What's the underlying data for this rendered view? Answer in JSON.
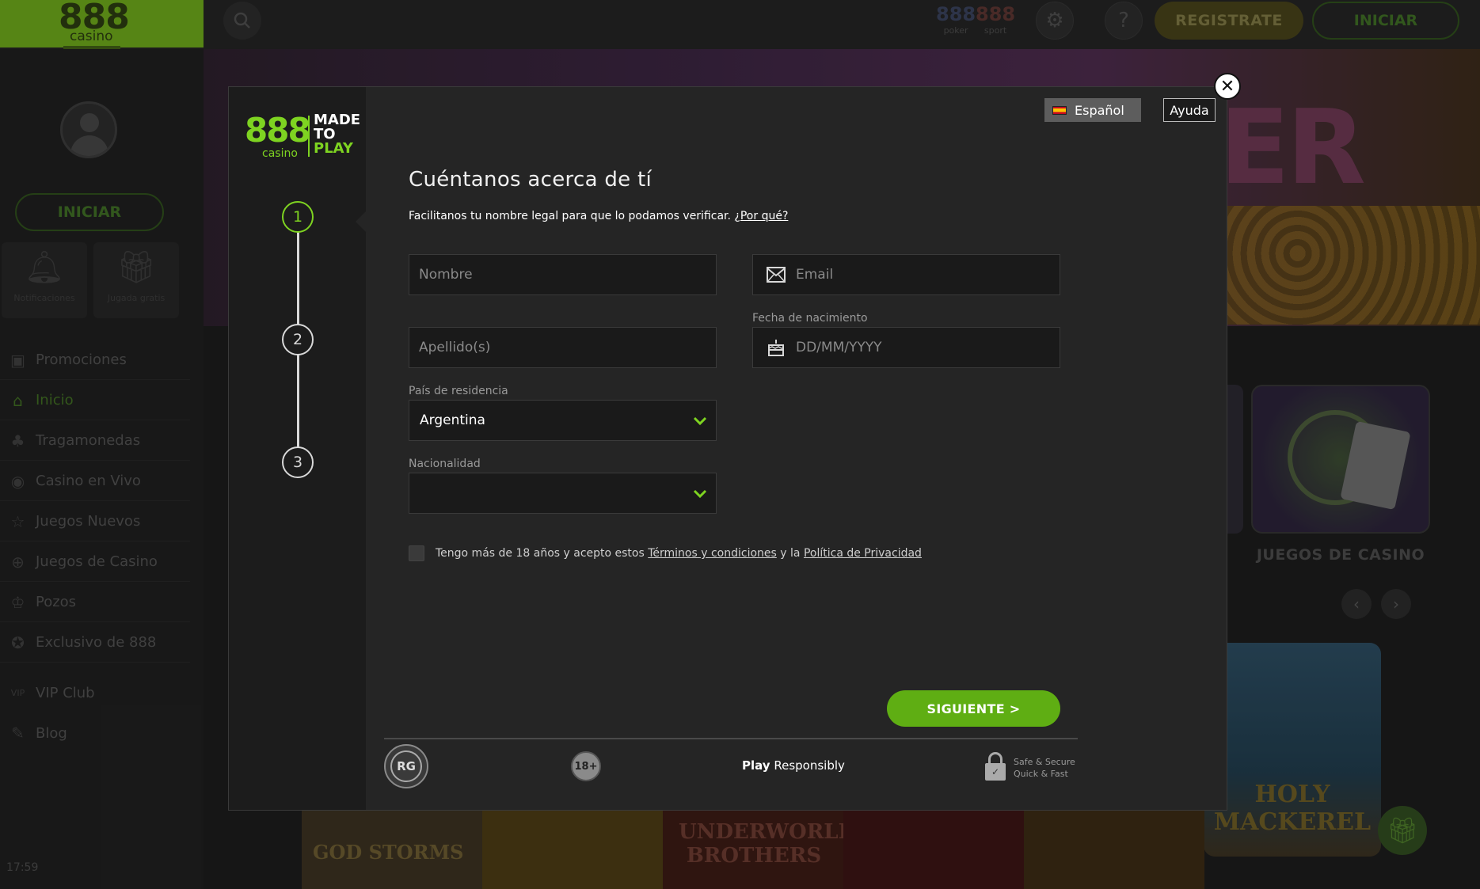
{
  "header": {
    "logo_main": "888",
    "logo_sub": "casino",
    "brands": [
      {
        "name": "888",
        "sub": "poker"
      },
      {
        "name": "888",
        "sub": "sport"
      }
    ],
    "register_label": "REGISTRATE",
    "login_label": "INICIAR"
  },
  "sidebar": {
    "login_label": "INICIAR",
    "tiles": [
      "Notificaciones",
      "Jugada gratis"
    ],
    "items": [
      {
        "label": "Promociones",
        "icon": "gift-icon"
      },
      {
        "label": "Inicio",
        "icon": "home-icon"
      },
      {
        "label": "Tragamonedas",
        "icon": "cherries-icon"
      },
      {
        "label": "Casino en Vivo",
        "icon": "live-icon"
      },
      {
        "label": "Juegos Nuevos",
        "icon": "star-icon"
      },
      {
        "label": "Juegos de Casino",
        "icon": "chip-icon"
      },
      {
        "label": "Pozos",
        "icon": "trophy-icon"
      },
      {
        "label": "Exclusivo de 888",
        "icon": "badge-icon"
      },
      {
        "label": "VIP Club",
        "icon": "vip-icon"
      },
      {
        "label": "Blog",
        "icon": "pen-icon"
      }
    ],
    "clock": "17:59"
  },
  "background": {
    "banner_text": "ER",
    "category_label": "JUEGOS DE CASINO",
    "game_thumbs": [
      "GOD STORMS",
      "UNDERWORLD BROTHERS",
      "HOLY MACKEREL"
    ]
  },
  "modal": {
    "logo_main": "888",
    "logo_sub": "casino",
    "tagline": [
      "MADE",
      "TO",
      "PLAY"
    ],
    "language": "Español",
    "help_label": "Ayuda",
    "title": "Cuéntanos acerca de tí",
    "subtitle": "Facilitanos tu nombre legal para que lo podamos verificar.",
    "why_link": "¿Por qué?",
    "steps": [
      "1",
      "2",
      "3"
    ],
    "fields": {
      "nombre_placeholder": "Nombre",
      "apellido_placeholder": "Apellido(s)",
      "email_placeholder": "Email",
      "dob_label": "Fecha de nacimiento",
      "dob_placeholder": "DD/MM/YYYY",
      "country_label": "País de residencia",
      "country_value": "Argentina",
      "nationality_label": "Nacionalidad",
      "nationality_value": ""
    },
    "terms": {
      "prefix": "Tengo más de 18 años y acepto estos",
      "terms_link": "Términos y condiciones",
      "middle": "y la",
      "privacy_link": "Política de Privacidad"
    },
    "next_label": "SIGUIENTE >",
    "footer": {
      "rg_label": "RG",
      "age_label": "18+",
      "play_bold": "Play",
      "play_rest": "Responsibly",
      "safe_line1": "Safe & Secure",
      "safe_line2": "Quick & Fast"
    }
  },
  "colors": {
    "accent_green": "#7ed321",
    "button_green": "#5fae13",
    "modal_bg": "#252525",
    "field_bg": "#1a1a1a"
  }
}
